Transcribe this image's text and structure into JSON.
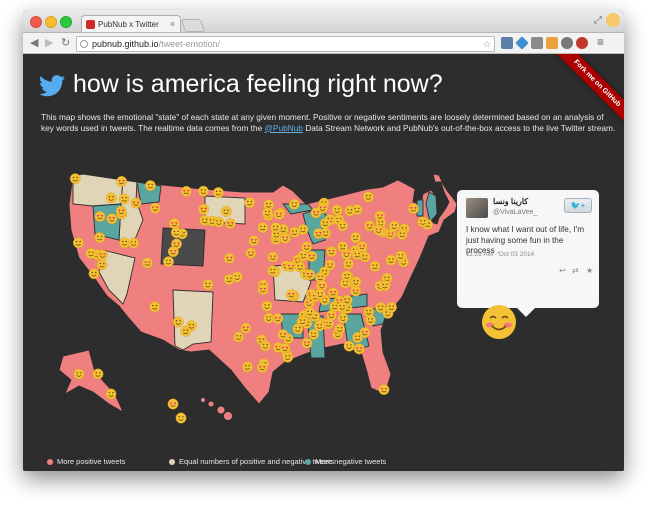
{
  "browser": {
    "tab_title": "PubNub x Twitter",
    "url_host": "pubnub.github.io",
    "url_path": "/tweet-emotion/"
  },
  "page": {
    "ribbon": "Fork me on GitHub",
    "title": "how is america feeling right now?",
    "description_before": "This map shows the emotional \"state\" of each state at any given moment. Positive or negative sentiments are loosely determined based on an analysis of key words used in tweets. The realtime data comes from the ",
    "description_link": "@PubNub",
    "description_after": " Data Stream Network and PubNub's out-of-the-box access to the live Twitter stream."
  },
  "tweet": {
    "name": "كارينا ونسا",
    "handle": "@VivaLaVee_",
    "follow": "+",
    "text": "I know what I want out of life, I'm just having some fun in the process .",
    "date": "11:29 AM - Oct 03 2014"
  },
  "legend": [
    {
      "label": "More positive tweets",
      "color": "#f08080"
    },
    {
      "label": "Equal numbers of positive and negative tweets",
      "color": "#e1d5b8"
    },
    {
      "label": "More negative tweets",
      "color": "#5aa5a0"
    }
  ],
  "colors": {
    "positive": "#f08080",
    "neutral": "#e1d5b8",
    "negative": "#5aa5a0",
    "nodata": "#4a4a4a",
    "emoji": "#f5c134",
    "heart": "#e0336a"
  }
}
